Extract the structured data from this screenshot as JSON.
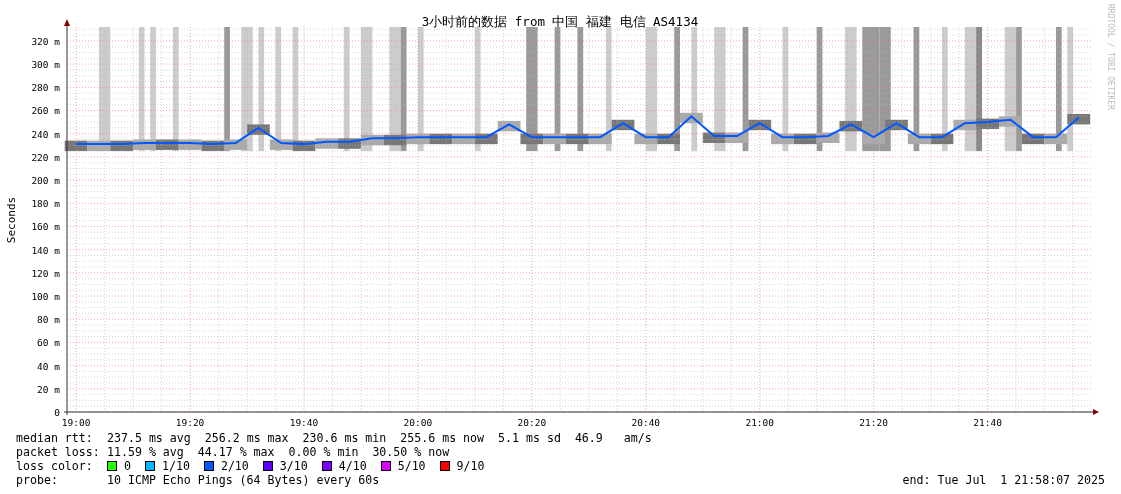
{
  "chart": {
    "watermark": "RRDTOOL / TOBI OETIKER",
    "chart_data": {
      "type": "line",
      "title": "3小时前的数据 from 中国 福建 电信 AS4134",
      "ylabel": "Seconds",
      "ylim": [
        0,
        332
      ],
      "grid": true,
      "categories": [
        "19:00",
        null,
        null,
        null,
        null,
        "19:20",
        null,
        null,
        null,
        null,
        "19:40",
        null,
        null,
        null,
        null,
        "20:00",
        null,
        null,
        null,
        null,
        "20:20",
        null,
        null,
        null,
        null,
        "20:40",
        null,
        null,
        null,
        null,
        "21:00",
        null,
        null,
        null,
        null,
        "21:20",
        null,
        null,
        null,
        null,
        "21:40",
        null,
        null,
        null,
        null
      ],
      "yticks": [
        {
          "value": 0,
          "label": "0"
        },
        {
          "value": 20,
          "label": "20 m"
        },
        {
          "value": 40,
          "label": "40 m"
        },
        {
          "value": 60,
          "label": "60 m"
        },
        {
          "value": 80,
          "label": "80 m"
        },
        {
          "value": 100,
          "label": "100 m"
        },
        {
          "value": 120,
          "label": "120 m"
        },
        {
          "value": 140,
          "label": "140 m"
        },
        {
          "value": 160,
          "label": "160 m"
        },
        {
          "value": 180,
          "label": "180 m"
        },
        {
          "value": 200,
          "label": "200 m"
        },
        {
          "value": 220,
          "label": "220 m"
        },
        {
          "value": 240,
          "label": "240 m"
        },
        {
          "value": 260,
          "label": "260 m"
        },
        {
          "value": 280,
          "label": "280 m"
        },
        {
          "value": 300,
          "label": "300 m"
        },
        {
          "value": 320,
          "label": "320 m"
        }
      ],
      "series": [
        {
          "color": "#0059ff",
          "values": [
            231,
            231,
            231,
            232,
            232,
            232,
            231,
            232,
            245,
            232,
            231,
            233,
            233,
            236,
            236,
            237,
            237,
            237,
            237,
            248,
            237,
            237,
            237,
            237,
            249,
            237,
            237,
            255,
            238,
            238,
            249,
            237,
            237,
            238,
            248,
            237,
            249,
            237,
            237,
            249,
            250,
            252,
            237,
            237,
            254
          ]
        }
      ]
    }
  },
  "legend": {
    "median_rtt": {
      "label": "median rtt:",
      "values": [
        "237.5 ms avg",
        "256.2 ms max",
        "230.6 ms min",
        "255.6 ms now",
        "5.1 ms sd",
        "46.9   am/s"
      ]
    },
    "packet_loss": {
      "label": "packet loss:",
      "values": [
        "11.59 % avg",
        "44.17 % max",
        "0.00 % min",
        "30.50 % now"
      ]
    },
    "loss_color": {
      "label": "loss color:",
      "items": [
        {
          "label": "0",
          "color": "#26ff00"
        },
        {
          "label": "1/10",
          "color": "#00b8ff"
        },
        {
          "label": "2/10",
          "color": "#0059ff"
        },
        {
          "label": "3/10",
          "color": "#5e00ff"
        },
        {
          "label": "4/10",
          "color": "#7e00ff"
        },
        {
          "label": "5/10",
          "color": "#dd00ff"
        },
        {
          "label": "9/10",
          "color": "#ff0000"
        }
      ]
    },
    "probe": {
      "label": "probe:",
      "value": "10 ICMP Echo Pings (64 Bytes) every 60s"
    },
    "end": "end: Tue Jul  1 21:58:07 2025"
  }
}
